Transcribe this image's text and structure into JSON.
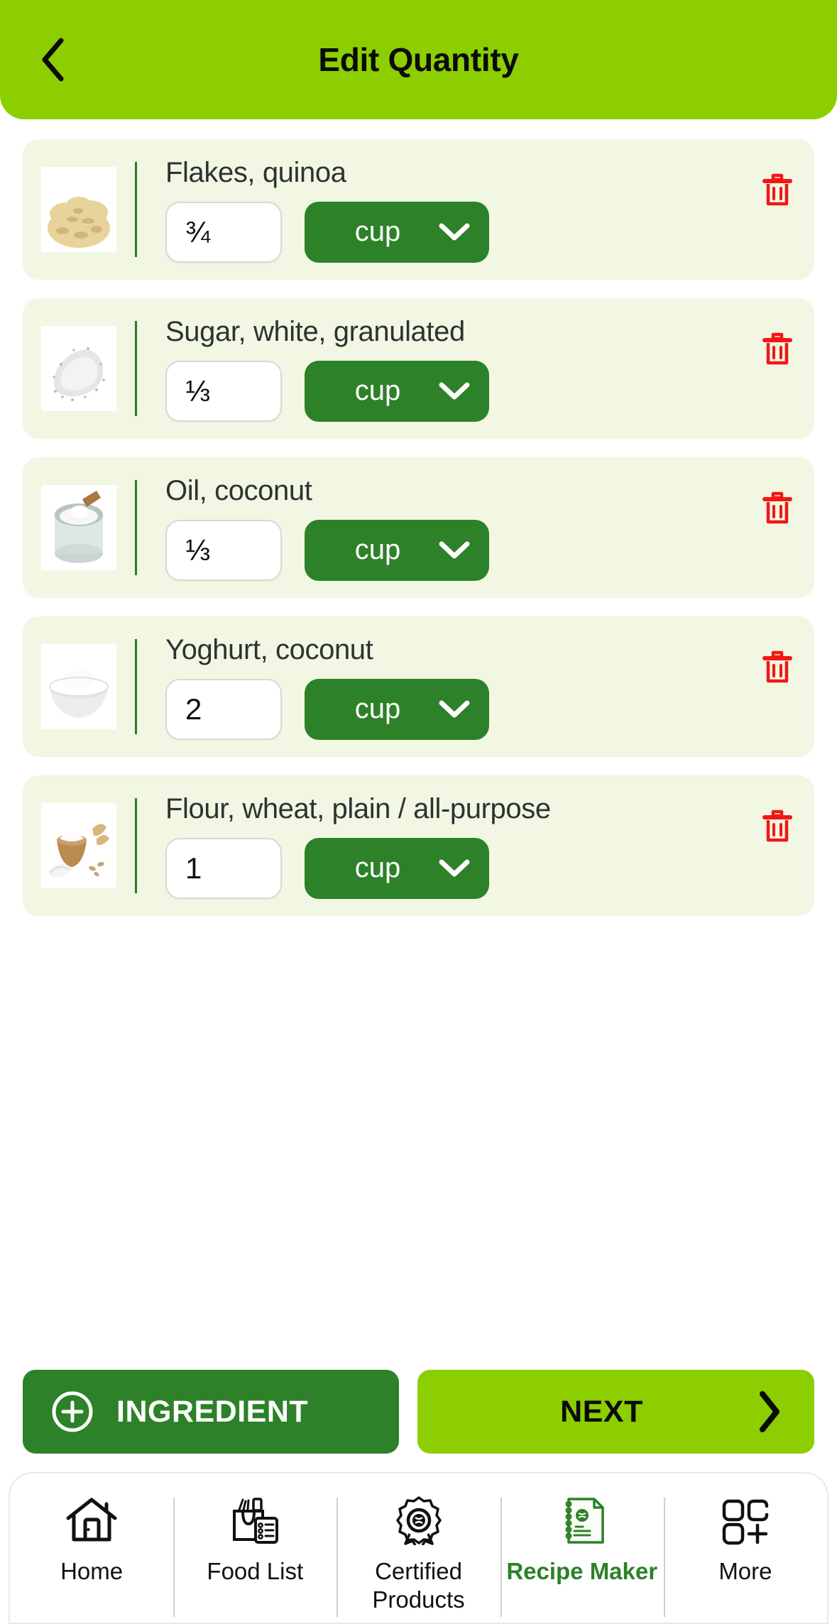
{
  "header": {
    "title": "Edit Quantity",
    "back_icon": "chevron-left-icon",
    "bg_color": "#8cce00"
  },
  "colors": {
    "brand_light_green": "#8cce00",
    "brand_dark_green": "#2d8128",
    "card_bg": "#f1f7e2",
    "trash_red": "#f31616",
    "divider_green": "#2d7a2a"
  },
  "ingredients": [
    {
      "name": "Flakes, quinoa",
      "quantity": "¾",
      "unit": "cup",
      "thumb_icon": "quinoa-flakes-thumbnail",
      "delete_icon": "trash-icon",
      "dropdown_icon": "chevron-down-icon"
    },
    {
      "name": "Sugar, white, granulated",
      "quantity": "⅓",
      "unit": "cup",
      "thumb_icon": "granulated-sugar-thumbnail",
      "delete_icon": "trash-icon",
      "dropdown_icon": "chevron-down-icon"
    },
    {
      "name": "Oil, coconut",
      "quantity": "⅓",
      "unit": "cup",
      "thumb_icon": "coconut-oil-jar-thumbnail",
      "delete_icon": "trash-icon",
      "dropdown_icon": "chevron-down-icon"
    },
    {
      "name": "Yoghurt, coconut",
      "quantity": "2",
      "unit": "cup",
      "thumb_icon": "coconut-yoghurt-bowl-thumbnail",
      "delete_icon": "trash-icon",
      "dropdown_icon": "chevron-down-icon"
    },
    {
      "name": "Flour, wheat, plain / all-purpose",
      "quantity": "1",
      "unit": "cup",
      "thumb_icon": "wheat-flour-bowl-thumbnail",
      "delete_icon": "trash-icon",
      "dropdown_icon": "chevron-down-icon"
    }
  ],
  "actions": {
    "add_ingredient_label": "INGREDIENT",
    "add_ingredient_icon": "plus-circle-icon",
    "next_label": "NEXT",
    "next_icon": "chevron-right-icon"
  },
  "bottom_nav": {
    "items": [
      {
        "label": "Home",
        "icon": "home-icon",
        "active": false
      },
      {
        "label": "Food List",
        "icon": "grocery-bag-list-icon",
        "active": false
      },
      {
        "label": "Certified Products",
        "icon": "certified-badge-icon",
        "active": false
      },
      {
        "label": "Recipe Maker",
        "icon": "recipe-notepad-icon",
        "active": true
      },
      {
        "label": "More",
        "icon": "grid-plus-icon",
        "active": false
      }
    ]
  }
}
